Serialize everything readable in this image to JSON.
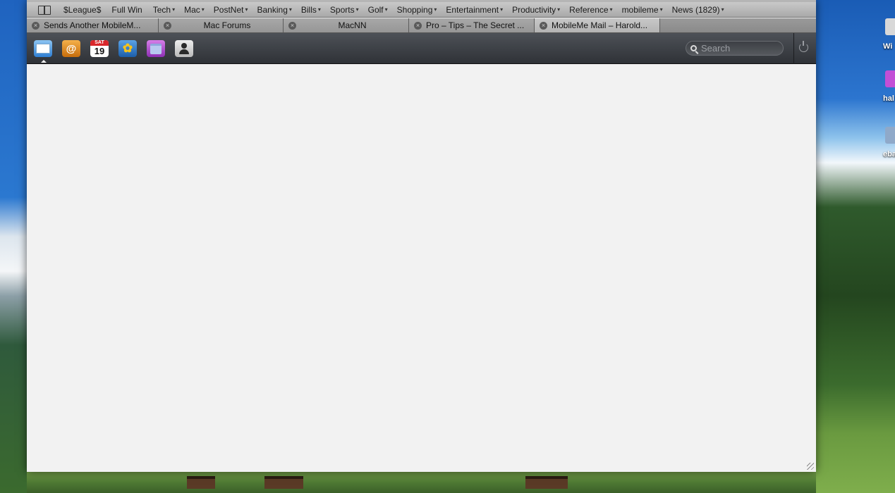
{
  "bookmarks": [
    {
      "label": "$League$",
      "arrow": ""
    },
    {
      "label": "Full Win",
      "arrow": ""
    },
    {
      "label": "Tech",
      "arrow": "▾"
    },
    {
      "label": "Mac",
      "arrow": "▾"
    },
    {
      "label": "PostNet",
      "arrow": "▾"
    },
    {
      "label": "Banking",
      "arrow": "▾"
    },
    {
      "label": "Bills",
      "arrow": "▾"
    },
    {
      "label": "Sports",
      "arrow": "▾"
    },
    {
      "label": "Golf",
      "arrow": "▾"
    },
    {
      "label": "Shopping",
      "arrow": "▾"
    },
    {
      "label": "Entertainment",
      "arrow": "▾"
    },
    {
      "label": "Productivity",
      "arrow": "▾"
    },
    {
      "label": "Reference",
      "arrow": "▾"
    },
    {
      "label": "mobileme",
      "arrow": "▾"
    },
    {
      "label": "News (1829)",
      "arrow": "▾"
    }
  ],
  "tabs": [
    {
      "title": "Sends Another MobileM...",
      "active": false
    },
    {
      "title": "Mac Forums",
      "active": false
    },
    {
      "title": "MacNN",
      "active": false
    },
    {
      "title": "Pro – Tips – The Secret ...",
      "active": false
    },
    {
      "title": "MobileMe Mail – Harold...",
      "active": true
    }
  ],
  "tab_close_glyph": "×",
  "mobileme": {
    "apps": [
      {
        "name": "Mail",
        "icon": "mail-icon",
        "active": true
      },
      {
        "name": "Contacts",
        "icon": "contacts-icon",
        "glyph": "@"
      },
      {
        "name": "Calendar",
        "icon": "calendar-icon",
        "day": "SAT",
        "date": "19"
      },
      {
        "name": "Gallery",
        "icon": "gallery-icon",
        "glyph": "✿"
      },
      {
        "name": "iDisk",
        "icon": "idisk-icon"
      },
      {
        "name": "Account",
        "icon": "account-icon"
      }
    ],
    "search_placeholder": "Search"
  },
  "desktop": {
    "labels": [
      "Wi",
      "hal",
      "eba"
    ]
  },
  "colors": {
    "toolbar_top": "#4d5157",
    "toolbar_bottom": "#2f3237",
    "content_bg": "#f2f2f2",
    "bookmarks_bar": "#b9b9b9"
  }
}
